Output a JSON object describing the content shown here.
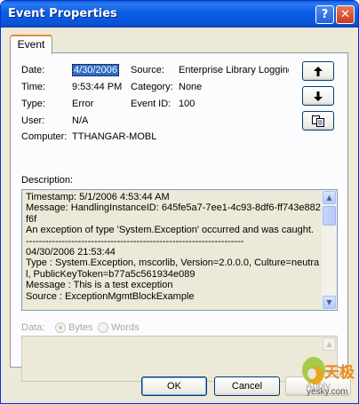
{
  "window": {
    "title": "Event Properties"
  },
  "titlebar_buttons": {
    "help": "?",
    "close": "✕"
  },
  "tab": {
    "label": "Event"
  },
  "fields": {
    "date_label": "Date:",
    "date_value": "4/30/2006",
    "time_label": "Time:",
    "time_value": "9:53:44 PM",
    "type_label": "Type:",
    "type_value": "Error",
    "user_label": "User:",
    "user_value": "N/A",
    "computer_label": "Computer:",
    "computer_value": "TTHANGAR-MOBL",
    "source_label": "Source:",
    "source_value": "Enterprise Library Logging",
    "category_label": "Category:",
    "category_value": "None",
    "eventid_label": "Event ID:",
    "eventid_value": "100"
  },
  "nav": {
    "up": "↑",
    "down": "↓",
    "copy": "copy-icon"
  },
  "description": {
    "label": "Description:",
    "text": "Timestamp: 5/1/2006 4:53:44 AM\nMessage: HandlingInstanceID: 645fe5a7-7ee1-4c93-8df6-ff743e882f6f\nAn exception of type 'System.Exception' occurred and was caught.\n-------------------------------------------------------------------\n04/30/2006 21:53:44\nType : System.Exception, mscorlib, Version=2.0.0.0, Culture=neutral, PublicKeyToken=b77a5c561934e089\nMessage : This is a test exception\nSource : ExceptionMgmtBlockExample"
  },
  "data_section": {
    "label": "Data:",
    "bytes": "Bytes",
    "words": "Words"
  },
  "buttons": {
    "ok": "OK",
    "cancel": "Cancel",
    "apply": "Apply"
  },
  "watermark": {
    "brand": "天极",
    "site": "yesky.com"
  },
  "colors": {
    "title_bar": "#0a54d6",
    "selection": "#316ac5",
    "tab_accent": "#e68b2c"
  }
}
